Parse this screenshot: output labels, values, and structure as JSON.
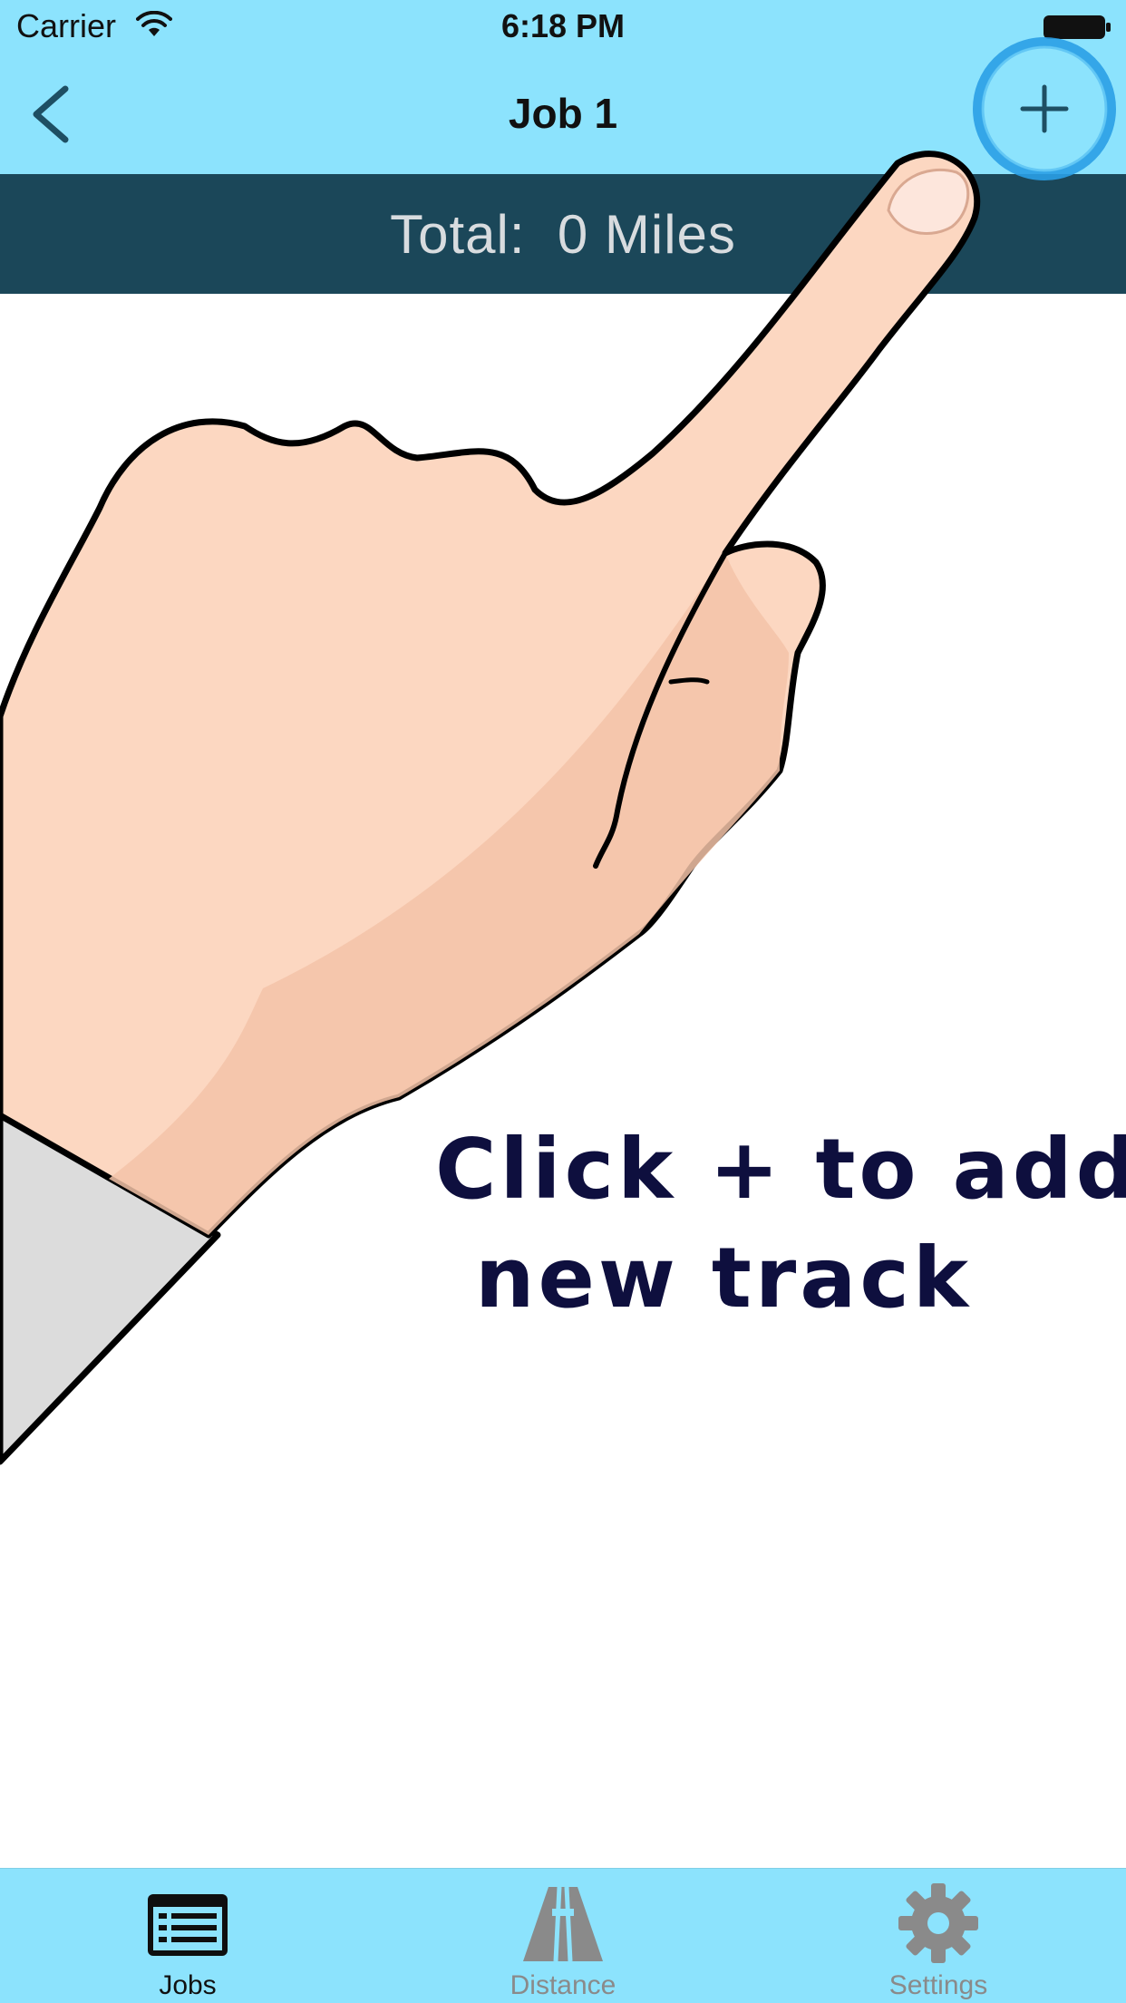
{
  "status_bar": {
    "carrier": "Carrier",
    "time": "6:18 PM",
    "icons": [
      "wifi-icon",
      "battery-icon"
    ]
  },
  "nav_bar": {
    "title": "Job 1",
    "back_icon": "chevron-left-icon",
    "add_icon": "plus-icon"
  },
  "summary": {
    "total_text": "Total:  0 Miles"
  },
  "hint": {
    "line1": "Click + to add",
    "line2": "new track"
  },
  "tab_bar": {
    "tabs": [
      {
        "label": "Jobs",
        "icon": "list-icon",
        "active": true
      },
      {
        "label": "Distance",
        "icon": "road-icon",
        "active": false
      },
      {
        "label": "Settings",
        "icon": "gear-icon",
        "active": false
      }
    ]
  },
  "colors": {
    "bar_background": "#8ce3fd",
    "total_background": "#1b4759",
    "add_ring": "#2a9ee6",
    "hint_text": "#0e0f3e"
  }
}
